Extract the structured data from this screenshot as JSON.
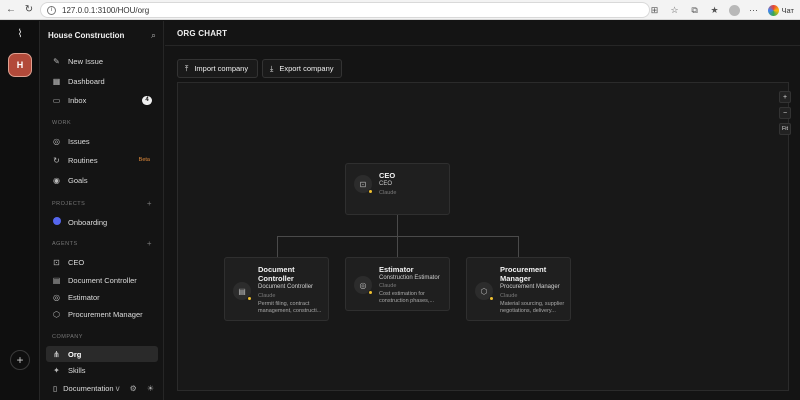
{
  "browser": {
    "url": "127.0.0.1:3100/HOU/org",
    "chat_label": "Чат"
  },
  "rail": {
    "avatar_letter": "H"
  },
  "sidebar": {
    "company_name": "House Construction",
    "top_items": [
      {
        "label": "New Issue",
        "icon": "pencil-icon"
      },
      {
        "label": "Dashboard",
        "icon": "grid-icon"
      },
      {
        "label": "Inbox",
        "icon": "inbox-icon",
        "count": "4"
      }
    ],
    "work_section": "WORK",
    "work_items": [
      {
        "label": "Issues",
        "icon": "circle-dot-icon"
      },
      {
        "label": "Routines",
        "icon": "repeat-icon",
        "badge": "Beta"
      },
      {
        "label": "Goals",
        "icon": "target-icon"
      }
    ],
    "projects_section": "PROJECTS",
    "projects": [
      {
        "label": "Onboarding",
        "color": "#5566ee"
      }
    ],
    "agents_section": "AGENTS",
    "agents": [
      {
        "label": "CEO",
        "icon": "bot-icon"
      },
      {
        "label": "Document Controller",
        "icon": "file-icon"
      },
      {
        "label": "Estimator",
        "icon": "target-icon"
      },
      {
        "label": "Procurement Manager",
        "icon": "box-icon"
      }
    ],
    "company_section": "COMPANY",
    "company_items": [
      {
        "label": "Org",
        "icon": "org-icon"
      },
      {
        "label": "Skills",
        "icon": "sparkle-icon"
      }
    ],
    "footer_label": "Documentation"
  },
  "main": {
    "title": "ORG CHART",
    "import_label": "Import company",
    "export_label": "Export company",
    "zoom_in": "+",
    "zoom_out": "−",
    "fit_label": "Fit"
  },
  "org": {
    "ceo": {
      "name": "CEO",
      "role": "CEO",
      "adapter": "Claude"
    },
    "reports": [
      {
        "name": "Document Controller",
        "role": "Document Controller",
        "adapter": "Claude",
        "desc": "Permit filing, contract management, constructi..."
      },
      {
        "name": "Estimator",
        "role": "Construction Estimator",
        "adapter": "Claude",
        "desc": "Cost estimation for construction phases,..."
      },
      {
        "name": "Procurement Manager",
        "role": "Procurement Manager",
        "adapter": "Claude",
        "desc": "Material sourcing, supplier negotiations, delivery..."
      }
    ]
  },
  "colors": {
    "status_dot": "#f0c030",
    "project_dot": "#5566ee",
    "beta": "#e08a3a"
  }
}
